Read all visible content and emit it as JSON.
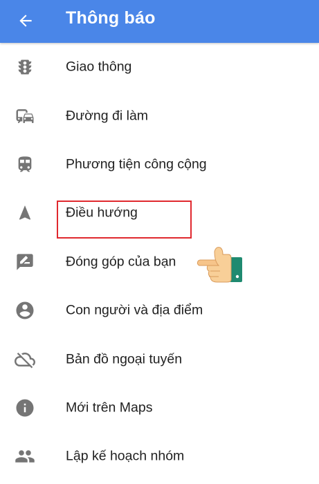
{
  "app_bar": {
    "title": "Thông báo",
    "back_icon": "arrow-back-icon",
    "background_color": "#4a86e8"
  },
  "menu_items": [
    {
      "label": "Giao thông",
      "icon": "traffic-light-icon"
    },
    {
      "label": "Đường đi làm",
      "icon": "commute-icon"
    },
    {
      "label": "Phương tiện công cộng",
      "icon": "transit-icon"
    },
    {
      "label": "Điều hướng",
      "icon": "navigation-icon"
    },
    {
      "label": "Đóng góp của bạn",
      "icon": "contribute-icon",
      "highlighted": true
    },
    {
      "label": "Con người và địa điểm",
      "icon": "account-circle-icon"
    },
    {
      "label": "Bản đồ ngoại tuyến",
      "icon": "cloud-off-icon"
    },
    {
      "label": "Mới trên Maps",
      "icon": "info-icon"
    },
    {
      "label": "Lập kế hoạch nhóm",
      "icon": "group-icon"
    }
  ],
  "annotation": {
    "highlight_color": "#e0282e",
    "pointer_icon": "pointing-hand-icon"
  }
}
